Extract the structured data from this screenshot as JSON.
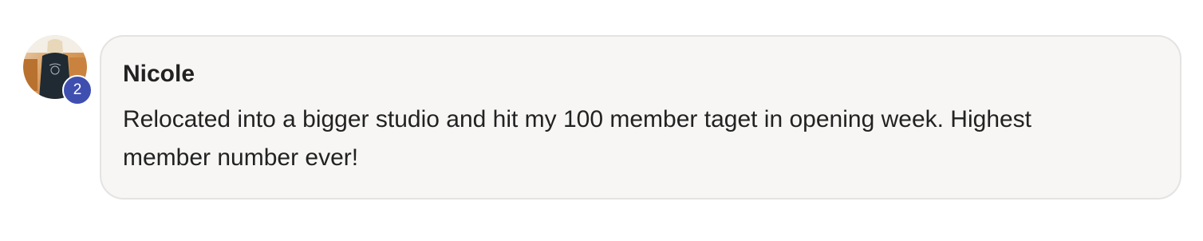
{
  "comment": {
    "author": "Nicole",
    "text": "Relocated into a bigger studio and hit my 100 member taget in opening week. Highest member number ever!",
    "badge_count": "2",
    "badge_color": "#3f4fb0",
    "bubble_background": "#f7f6f4",
    "avatar_icon": "user-photo-avatar"
  }
}
